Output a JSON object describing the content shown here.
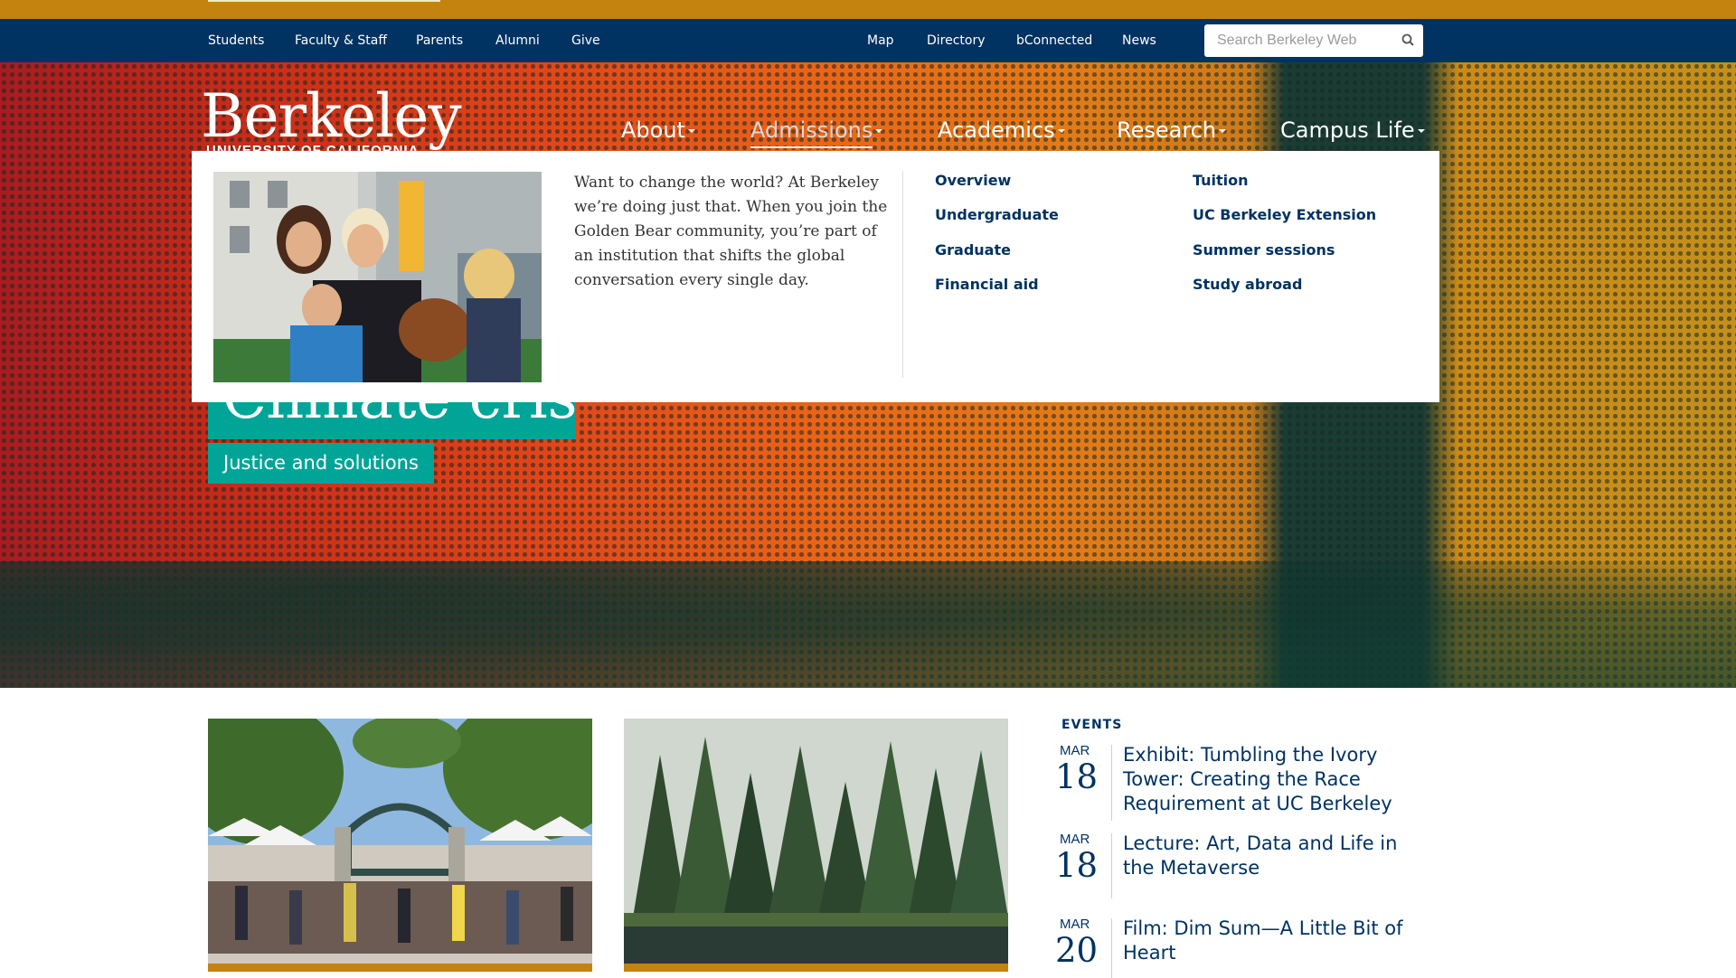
{
  "utility_nav": {
    "left_links": [
      "Students",
      "Faculty & Staff",
      "Parents",
      "Alumni",
      "Give"
    ],
    "right_links": [
      "Map",
      "Directory",
      "bConnected",
      "News"
    ],
    "search_placeholder": "Search Berkeley Web",
    "search_icon": "search-icon"
  },
  "logo": {
    "wordmark": "Berkeley",
    "subtitle": "UNIVERSITY OF CALIFORNIA"
  },
  "main_nav": {
    "items": [
      "About",
      "Admissions",
      "Academics",
      "Research",
      "Campus Life"
    ],
    "active": "Admissions"
  },
  "mega_menu": {
    "description": "Want to change the world? At Berkeley we’re doing just that. When you join the Golden Bear community, you’re part of an institution that shifts the global conversation every single day.",
    "col1": [
      "Overview",
      "Undergraduate",
      "Graduate",
      "Financial aid"
    ],
    "col2": [
      "Tuition",
      "UC Berkeley Extension",
      "Summer sessions",
      "Study abroad"
    ]
  },
  "hero": {
    "headline": "Climate crisis",
    "subhead": "Justice and solutions"
  },
  "events": {
    "heading": "EVENTS",
    "items": [
      {
        "month": "MAR",
        "day": "18",
        "title": "Exhibit: Tumbling the Ivory Tower: Creating the Race Requirement at UC Berkeley"
      },
      {
        "month": "MAR",
        "day": "18",
        "title": "Lecture: Art, Data and Life in the Metaverse"
      },
      {
        "month": "MAR",
        "day": "20",
        "title": "Film: Dim Sum—A Little Bit of Heart"
      }
    ]
  },
  "colors": {
    "berkeley_blue": "#003262",
    "california_gold": "#C4820E",
    "teal": "#00A598"
  }
}
